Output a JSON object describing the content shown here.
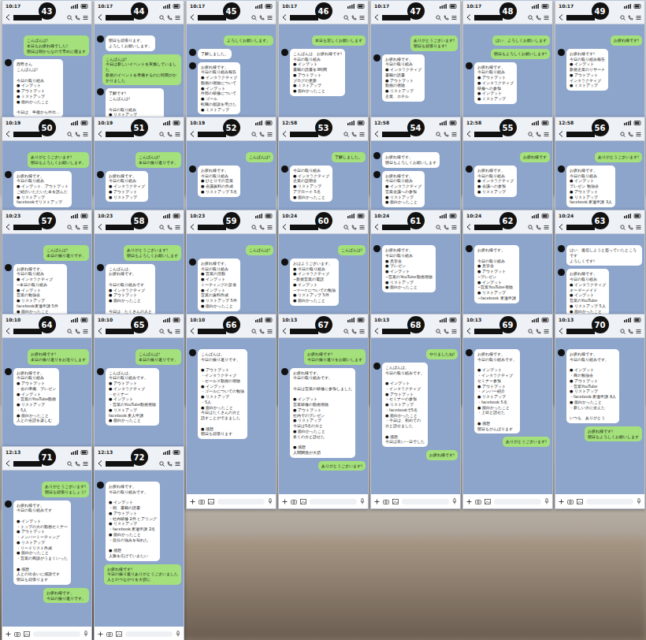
{
  "screenshots": [
    {
      "number": "43",
      "time": "10:17",
      "bubbles": [
        {
          "kind": "sent",
          "lines": [
            "こんばんは!",
            "本日もお疲れ様でした!",
            "明日は朝からなので早めに寝ます"
          ]
        },
        {
          "kind": "received",
          "lines": [
            "西野さん",
            "こんばんは!",
            "",
            "今日の取り組み",
            "● インプット",
            "● アウトプット",
            "● ミストアップ",
            "● 面白かったこと",
            "",
            "今日は、午後から外出…"
          ]
        }
      ]
    },
    {
      "number": "44",
      "time": "10:17",
      "bubbles": [
        {
          "kind": "received",
          "lines": [
            "明日も頑張ります。",
            "よろしくお願いします。"
          ]
        },
        {
          "kind": "sent",
          "lines": [
            "こんばんは!",
            "今日は新しいイベントを実施していました",
            "新規のイベントを準備するのに時間がかかりました"
          ]
        },
        {
          "kind": "received",
          "lines": [
            "了解です!",
            "こんばんは!",
            "",
            "今日の取り組み",
            "● リストアップ",
            "● インプット、アウトプット",
            "● 面白かったこと"
          ]
        }
      ]
    },
    {
      "number": "45",
      "time": "10:17",
      "bubbles": [
        {
          "kind": "sent",
          "lines": [
            "よろしくお願いします。"
          ]
        },
        {
          "kind": "received",
          "lines": [
            "了解しました。"
          ]
        },
        {
          "kind": "received",
          "lines": [
            "お疲れ様です。",
            "今日の取り組み報告",
            "● インタラクティブ",
            "  動画の視聴について",
            "● インプット",
            "  外部の研修について",
            "● ゴール",
            "  転職の面談を受けた",
            "● ミストアップ"
          ]
        }
      ]
    },
    {
      "number": "46",
      "time": "10:17",
      "bubbles": [
        {
          "kind": "sent",
          "lines": [
            "本日も宜しくお願いします"
          ]
        },
        {
          "kind": "received",
          "lines": [
            "こんばんは、お疲れ様です!",
            "今日の取り組み",
            "● インプット",
            "  書籍の読書を3時間",
            "● アウトプット",
            "  ブログの更新",
            "● ミストアップ",
            "● 面白かったこと"
          ]
        }
      ]
    },
    {
      "number": "47",
      "time": "10:17",
      "bubbles": [
        {
          "kind": "sent",
          "lines": [
            "ありがとうございます!",
            "明日も頑張ります!"
          ]
        },
        {
          "kind": "received",
          "lines": [
            "お疲れ様です。",
            "今日の取り組み",
            "● インタラクティブ",
            "  書籍の読書",
            "● アウトプット",
            "  動画の視聴",
            "● リストアップ",
            "  企業、ホテル"
          ]
        }
      ]
    },
    {
      "number": "48",
      "time": "10:17",
      "bubbles": [
        {
          "kind": "sent",
          "lines": [
            "はい、よろしくお願いします"
          ]
        },
        {
          "kind": "sent",
          "lines": [
            "明日もよろしくお願いします!"
          ]
        },
        {
          "kind": "received",
          "lines": [
            "お疲れ様です。",
            "今日の取り組み",
            "● アウトプット",
            "● インタラクティブ",
            "  研修への参加",
            "● インプット",
            "● ミストアップ"
          ]
        }
      ]
    },
    {
      "number": "49",
      "time": "10:17",
      "bubbles": [
        {
          "kind": "sent",
          "lines": [
            "お疲れ様です!"
          ]
        },
        {
          "kind": "received",
          "lines": [
            "お疲れ様です!",
            "今日の取り組み報告",
            "● インプット",
            "  新規企業のリサーチ",
            "● アウトプット",
            "  インタラクティブ",
            "● ミストアップ"
          ]
        }
      ]
    },
    {
      "number": "50",
      "time": "10:19",
      "bubbles": [
        {
          "kind": "sent",
          "lines": [
            "ありがとうございます!",
            "明日もよろしくお願いします。"
          ]
        },
        {
          "kind": "received",
          "lines": [
            "お疲れ様です。",
            "今日の取り組み",
            "● インプット、アウトプット",
            "  ご紹介いただいた本を読んだ",
            "● リストアップ",
            "  facebookでリストアップ"
          ]
        }
      ]
    },
    {
      "number": "51",
      "time": "10:19",
      "bubbles": [
        {
          "kind": "sent",
          "lines": [
            "こんばんは!",
            "本日の振り返りです。"
          ]
        },
        {
          "kind": "received",
          "lines": [
            "お疲れ様です。",
            "今日の取り組み",
            "● インタラクティブ",
            "● アウトプット",
            "● リストアップ"
          ]
        }
      ]
    },
    {
      "number": "52",
      "time": "10:19",
      "bubbles": [
        {
          "kind": "sent",
          "lines": [
            "こんばんは!"
          ]
        },
        {
          "kind": "received",
          "lines": [
            "お疲れ様です。",
            "今日の取り組み",
            "● ひとりでの営業",
            "● 会議資料の作成",
            "● リストアップ 5名"
          ]
        }
      ]
    },
    {
      "number": "53",
      "time": "12:58",
      "bubbles": [
        {
          "kind": "sent",
          "lines": [
            "了解しました。"
          ]
        },
        {
          "kind": "received",
          "lines": [
            "今日の取り組み",
            "● インタラクティブ",
            "  企業の説明会",
            "● リストアップ",
            "  アプローチ 5名",
            "● 面白かったこと"
          ]
        }
      ]
    },
    {
      "number": "54",
      "time": "12:58",
      "bubbles": [
        {
          "kind": "received",
          "lines": [
            "お疲れ様です。",
            "明日もよろしくお願いします"
          ]
        },
        {
          "kind": "received",
          "lines": [
            "お疲れ様です。",
            "今日の取り組み",
            "● インタラクティブ",
            "  営業会議への参加",
            "● リストアップ",
            "● 面白かったこと"
          ]
        }
      ]
    },
    {
      "number": "55",
      "time": "12:58",
      "bubbles": [
        {
          "kind": "sent",
          "lines": [
            "お疲れ様です"
          ]
        },
        {
          "kind": "received",
          "lines": [
            "お疲れ様です。",
            "今日の取り組み",
            "● インタラクティブ",
            "● 会議への参加",
            "● リストアップ"
          ]
        }
      ]
    },
    {
      "number": "56",
      "time": "12:58",
      "bubbles": [
        {
          "kind": "sent",
          "lines": [
            "ありがとうございます!"
          ]
        },
        {
          "kind": "received",
          "lines": [
            "お疲れ様です。",
            "今日の取り組み",
            "● インプット",
            "  プレゼン 勉強会",
            "● アウトプット",
            "● リストアップ",
            "  facebook 友達申請 3人"
          ]
        }
      ]
    },
    {
      "number": "57",
      "time": "10:23",
      "bubbles": [
        {
          "kind": "sent",
          "lines": [
            "こんばんは!",
            "本日の振り返りです。"
          ]
        },
        {
          "kind": "received",
          "lines": [
            "お疲れ様です。",
            "今日の取り組み",
            "● インタラクティブ",
            "  ~本日の取り組み",
            "● インプット",
            "  営業の勉強会",
            "● リストアップ",
            "  facebook友達申請 5件",
            "● 面白かったこと",
            "  なくなったとのことで",
            "  新しい方がいらっしゃった"
          ]
        }
      ]
    },
    {
      "number": "58",
      "time": "10:23",
      "bubbles": [
        {
          "kind": "sent",
          "lines": [
            "ありがとうございます!",
            "明日もよろしくお願いします"
          ]
        },
        {
          "kind": "received",
          "lines": [
            "こんばんは。",
            "お疲れ様です。",
            "",
            "今日の取り組みです",
            "● インタラクティブ",
            "● アウトプット",
            "● 面白かったこと",
            "",
            "今日は、たくさんの人と",
            "話すことができました。"
          ]
        }
      ]
    },
    {
      "number": "59",
      "time": "10:23",
      "bubbles": [
        {
          "kind": "sent",
          "lines": [
            "こんばんは!"
          ]
        },
        {
          "kind": "received",
          "lines": [
            "お疲れ様です。",
            "今日の取り組み",
            "● 営業の活動",
            "● インプット",
            "  ミーティングの反省",
            "● インプット",
            "  営業の資料作成",
            "● リストアップ 5件",
            "● 面白かったこと"
          ]
        }
      ]
    },
    {
      "number": "60",
      "time": "10:24",
      "bubbles": [
        {
          "kind": "sent",
          "lines": [
            "こんばんは!"
          ]
        },
        {
          "kind": "received",
          "lines": [
            "おはようございます。",
            "● 今日の取り組み",
            "● インタラクティブ",
            "  ~新規営業の電話",
            "● インプット",
            "  ~マーケについての勉強",
            "● リストアップ 5件",
            "● 面白かったこと"
          ]
        }
      ]
    },
    {
      "number": "61",
      "time": "10:24",
      "bubbles": [
        {
          "kind": "received",
          "lines": [
            "お疲れ様です。",
            "今日の取り組み",
            "● 見学会",
            "● プレゼン",
            "● インプット",
            "  ~営業のYouTube動画視聴",
            "● リストアップ",
            "● 面白かったこと"
          ]
        }
      ]
    },
    {
      "number": "62",
      "time": "10:24",
      "bubbles": [
        {
          "kind": "received",
          "lines": [
            "お疲れ様です。",
            "",
            "今日の取り組み",
            "● 見学会",
            "● アウトプット",
            "  ~プレゼン",
            "● インプット",
            "  ~営業YouTube視聴",
            "● リストアップ",
            "  ~facebook 友達申請"
          ]
        }
      ]
    },
    {
      "number": "63",
      "time": "10:24",
      "bubbles": [
        {
          "kind": "received",
          "lines": [
            "はい、返信しようと思っていたところです",
            "よろしくです!"
          ]
        },
        {
          "kind": "received",
          "lines": [
            "お疲れ様です。",
            "今日の取り組み",
            "● インタラクティブ",
            "  オーダーメイド",
            "● インプット",
            "  営業のYouTube",
            "● リストアップ 5人",
            "● 面白かったこと"
          ]
        }
      ]
    },
    {
      "number": "64",
      "time": "10:10",
      "bubbles": [
        {
          "kind": "sent",
          "lines": [
            "お疲れ様です!",
            "本日の振り返りをお送りします"
          ]
        },
        {
          "kind": "received",
          "lines": [
            "お疲れ様です。",
            "今日の取り組み",
            "● アウトプット",
            "  ・会の準備、プレゼン",
            "● インプット",
            "  ・営業のYouTube動画",
            "● リストアップ",
            "  ・5人",
            "● 面白かったこと",
            "  人との会話を楽しむ"
          ]
        }
      ]
    },
    {
      "number": "65",
      "time": "10:10",
      "bubbles": [
        {
          "kind": "sent",
          "lines": [
            "こんばんは!",
            "本日の振り返りです。"
          ]
        },
        {
          "kind": "received",
          "lines": [
            "こんばんは。",
            "今日の取り組みです。",
            "● アウトプット",
            "● インタラクティブ",
            "  ・セミナー",
            "● インプット",
            "  ・営業のYouTube動画視聴",
            "● リストアップ",
            "  facebook 友人申請",
            "● 面白かったこと"
          ]
        }
      ]
    },
    {
      "number": "66",
      "time": "10:10",
      "bubbles": [
        {
          "kind": "received",
          "lines": [
            "こんばんは。",
            "今日の振り返りです。",
            "",
            "● アウトプット",
            "  ・インタラクティブ",
            "  ・セールス動画の視聴",
            "● インプット",
            "  ・ゴールについての勉強",
            "● リストアップ",
            "  ・5人",
            "● 面白かったこと",
            "  今日はたくさんの方と",
            "  話すことができました",
            "",
            "● 感想",
            "  明日も頑張ります"
          ]
        }
      ]
    },
    {
      "number": "67",
      "time": "10:13",
      "bubbles": [
        {
          "kind": "sent",
          "lines": [
            "お疲れ様です!",
            "今日の振り返りをお願いします"
          ]
        },
        {
          "kind": "received",
          "lines": [
            "お疲れ様です。",
            "今日の取り組みです。",
            "",
            "今日は営業の研修に参加しました",
            "",
            "● インプット",
            "  営業研修の動画視聴",
            "● アウトプット",
            "  社内でのプレゼン",
            "● リストアップ",
            "  今日は5名の方と",
            "● 面白かったこと",
            "  多くの方と話せた",
            "",
            "● 感想",
            "  人間関係が大切"
          ]
        },
        {
          "kind": "sent",
          "lines": [
            "ありがとうございます!"
          ]
        }
      ]
    },
    {
      "number": "68",
      "time": "10:13",
      "bubbles": [
        {
          "kind": "sent",
          "lines": [
            "やりましたね!"
          ]
        },
        {
          "kind": "received",
          "lines": [
            "こんばんは。",
            "今日の取り組みです。",
            "",
            "● インプット",
            "  ・インタラクティブ",
            "● アウトプット",
            "  ・セミナーの参加",
            "● リストアップ",
            "  ・facebookで5名",
            "● 面白かったこと",
            "  ・今日は、初めての",
            "  方と話せました",
            "",
            "● 感想",
            "  今日は良い一日でした"
          ]
        },
        {
          "kind": "sent",
          "lines": [
            "お疲れ様です!"
          ]
        }
      ]
    },
    {
      "number": "69",
      "time": "10:13",
      "bubbles": [
        {
          "kind": "received",
          "lines": [
            "お疲れ様です。",
            "今日の取り組みです。",
            "",
            "● インプット",
            "  ・インタラクティブ",
            "  セミナー参加",
            "● アウトプット",
            "  ・メンバー紹介",
            "● リストアップ",
            "  ・facebook 5名",
            "● 面白かったこと",
            "  ・上司と話せた",
            "",
            "● 感想",
            "  明日もがんばります"
          ]
        },
        {
          "kind": "sent",
          "lines": [
            "ありがとうございます!"
          ]
        }
      ]
    },
    {
      "number": "70",
      "time": "10:13",
      "bubbles": [
        {
          "kind": "received",
          "lines": [
            "お疲れ様です。",
            "今日の取り組みです。",
            "",
            "● インプット",
            "  ・商の勉強会",
            "● アウトプット",
            "  ・営業YouTube",
            "● リストアップ",
            "  ・facebook 友達申請 8人",
            "● 面白かったこと",
            "  ・新しい方に会えた",
            "",
            "いつも、ありがとう"
          ]
        },
        {
          "kind": "sent",
          "lines": [
            "お疲れ様です!",
            "明日もよろしくお願いします"
          ]
        }
      ]
    },
    {
      "number": "71",
      "time": "12:13",
      "bubbles": [
        {
          "kind": "sent",
          "lines": [
            "ありがとうございます!",
            "明日も頑張りましょう!"
          ]
        },
        {
          "kind": "received",
          "lines": [
            "お疲れ様です。",
            "今日の取り組みです",
            "",
            "● インプット",
            "  ・トップの方の動画セミナー",
            "● アウトプット",
            "  ・メンバーミーティング",
            "● リストアップ",
            "  ・リードリスト作成",
            "● 面白かったこと",
            "  ・営業の商談がうまくいった",
            "",
            "● 感想",
            "  人との出会いに感謝です",
            "  明日も頑張ります"
          ]
        },
        {
          "kind": "sent",
          "lines": [
            "お疲れ様です。",
            "今日の振り返りです。"
          ]
        }
      ]
    },
    {
      "number": "72",
      "time": "12:13",
      "bubbles": [
        {
          "kind": "received",
          "lines": [
            "お疲れ様です。",
            "今日の取り組みです。",
            "",
            "● インプット",
            "  ・朝、書籍の読書",
            "● アウトプット",
            "  ・社内研修 2件 ヒアリング",
            "● リストアップ",
            "  ・facebook 友達申請 2名",
            "● 面白かったこと",
            "  ・自分の強みを知れた",
            "",
            "● 感想",
            "  人脈を広げていきたい"
          ]
        },
        {
          "kind": "sent",
          "lines": [
            "お疲れ様です!",
            "今日の振り返りありがとうございました",
            "人とのつながりを大切に"
          ]
        }
      ]
    }
  ]
}
